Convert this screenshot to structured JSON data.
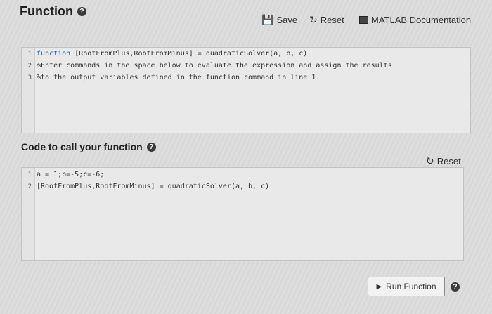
{
  "header": {
    "title": "Function"
  },
  "toolbar": {
    "save_label": "Save",
    "reset_label": "Reset",
    "docs_label": "MATLAB Documentation"
  },
  "function_editor": {
    "lines": [
      {
        "num": "1",
        "keyword": "function",
        "rest": " [RootFromPlus,RootFromMinus] = quadraticSolver(a, b, c)"
      },
      {
        "num": "2",
        "keyword": "",
        "rest": "%Enter commands in the space below to evaluate the expression and assign the results"
      },
      {
        "num": "3",
        "keyword": "",
        "rest": "%to the output variables defined in the function command in line 1."
      }
    ]
  },
  "call_section": {
    "title": "Code to call your function",
    "reset_label": "Reset"
  },
  "call_editor": {
    "lines": [
      {
        "num": "1",
        "keyword": "",
        "rest": "a = 1;b=-5;c=-6;"
      },
      {
        "num": "2",
        "keyword": "",
        "rest": "[RootFromPlus,RootFromMinus] = quadraticSolver(a, b, c)"
      }
    ]
  },
  "run_button": {
    "label": "Run Function"
  }
}
